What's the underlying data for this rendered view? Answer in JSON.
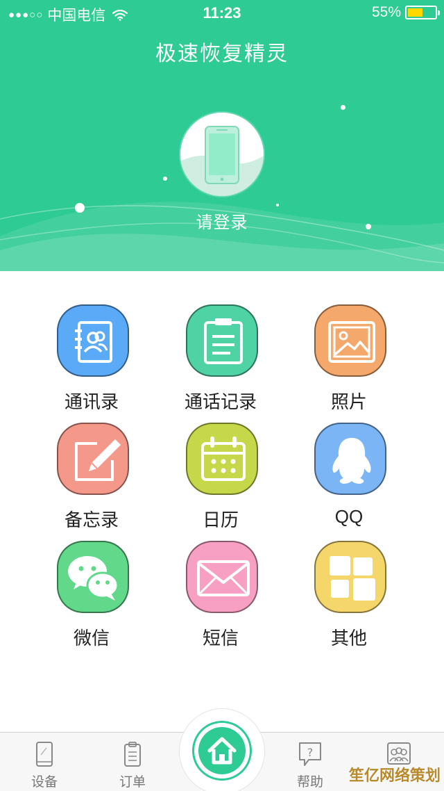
{
  "status_bar": {
    "signal": "●●●○○",
    "carrier": "中国电信",
    "time": "11:23",
    "battery_percent": "55%",
    "battery_level": 0.55
  },
  "header": {
    "title": "极速恢复精灵",
    "login_text": "请登录",
    "avatar_icon": "phone-icon"
  },
  "menu": [
    {
      "label": "通讯录",
      "icon": "contacts-icon",
      "color": "#5aaaf8"
    },
    {
      "label": "通话记录",
      "icon": "call-log-icon",
      "color": "#4fd2a4"
    },
    {
      "label": "照片",
      "icon": "photo-icon",
      "color": "#f5a86b"
    },
    {
      "label": "备忘录",
      "icon": "memo-icon",
      "color": "#f4988a"
    },
    {
      "label": "日历",
      "icon": "calendar-icon",
      "color": "#c6d84a"
    },
    {
      "label": "QQ",
      "icon": "qq-icon",
      "color": "#7bb5f5"
    },
    {
      "label": "微信",
      "icon": "wechat-icon",
      "color": "#61d88a"
    },
    {
      "label": "短信",
      "icon": "sms-icon",
      "color": "#f7a0c3"
    },
    {
      "label": "其他",
      "icon": "other-icon",
      "color": "#f5d66a"
    }
  ],
  "tabbar": {
    "tabs": [
      {
        "label": "设备",
        "icon": "device-icon"
      },
      {
        "label": "订单",
        "icon": "order-icon"
      },
      {
        "label": "帮助",
        "icon": "help-icon"
      },
      {
        "label": "",
        "icon": "user-group-icon"
      }
    ],
    "home_icon": "home-icon"
  },
  "watermark": "笙亿网络策划",
  "colors": {
    "brand": "#2ecb94"
  }
}
